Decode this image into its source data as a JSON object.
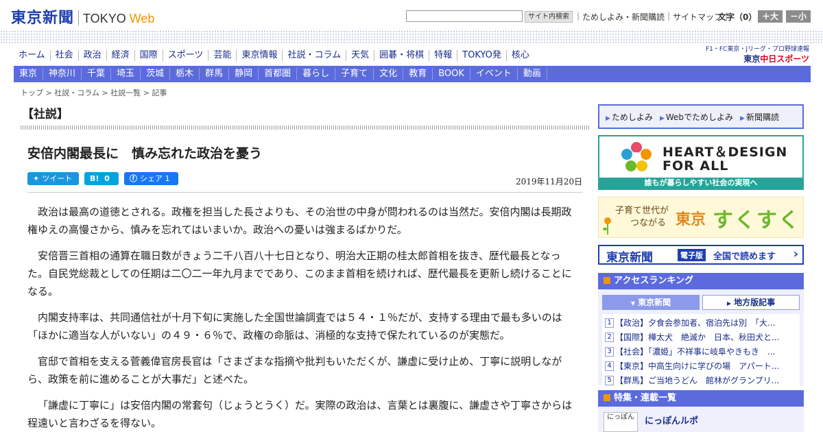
{
  "header": {
    "logo_jp": "東京新聞",
    "logo_en": "TOKYO",
    "logo_en_web": "Web",
    "search_button": "サイト内検索",
    "links": [
      "ためしよみ・新聞購読",
      "サイトマップ"
    ],
    "fontsize_label": "文字（0）",
    "font_large": "＋大",
    "font_small": "－小"
  },
  "nav_main": [
    "ホーム",
    "社会",
    "政治",
    "経済",
    "国際",
    "スポーツ",
    "芸能",
    "東京情報",
    "社説・コラム",
    "天気",
    "囲碁・将棋",
    "特報",
    "TOKYO発",
    "核心"
  ],
  "chunichi": {
    "top": "F1・FC東京・Jリーグ・プロ野球速報",
    "prefix": "東京",
    "main": "中日スポーツ"
  },
  "nav_regional": [
    "東京",
    "神奈川",
    "千葉",
    "埼玉",
    "茨城",
    "栃木",
    "群馬",
    "静岡",
    "首都圏",
    "暮らし",
    "子育て",
    "文化",
    "教育",
    "BOOK",
    "イベント",
    "動画"
  ],
  "breadcrumb": [
    "トップ",
    "社説・コラム",
    "社説一覧",
    "記事"
  ],
  "breadcrumb_sep": " > ",
  "article": {
    "category": "【社説】",
    "headline": "安倍内閣最長に　慎み忘れた政治を憂う",
    "date": "2019年11月20日",
    "tweet_label": "ツイート",
    "hatena_label": "B!",
    "hatena_count": "0",
    "fb_label": "シェア",
    "fb_count": "1",
    "paragraphs": [
      "政治は最高の道徳とされる。政権を担当した長さよりも、その治世の中身が問われるのは当然だ。安倍内閣は長期政権ゆえの高慢さから、慎みを忘れてはいまいか。政治への憂いは強まるばかりだ。",
      "安倍晋三首相の通算在職日数がきょう二千八百八十七日となり、明治大正期の桂太郎首相を抜き、歴代最長となった。自民党総裁としての任期は二〇二一年九月までであり、このまま首相を続ければ、歴代最長を更新し続けることになる。",
      "内閣支持率は、共同通信社が十月下旬に実施した全国世論調査では５４・１％だが、支持する理由で最も多いのは「ほかに適当な人がいない」の４９・６％で、政権の命脈は、消極的な支持で保たれているのが実態だ。",
      "官邸で首相を支える菅義偉官房長官は「さまざまな指摘や批判もいただくが、謙虚に受け止め、丁寧に説明しながら、政策を前に進めることが大事だ」と述べた。",
      "「謙虚に丁寧に」は安倍内閣の常套句（じょうとうく）だ。実際の政治は、言葉とは裏腹に、謙虚さや丁寧さからは程遠いと言わざるを得ない。"
    ]
  },
  "sidebar": {
    "trial_links": [
      "ためしよみ",
      "Webでためしよみ",
      "新聞購読"
    ],
    "heart_design_1": "HEART＆DESIGN",
    "heart_design_2": "FOR ALL",
    "heart_design_foot": "誰もが暮らしやすい社会の実現へ",
    "suku_sub1": "子育て世代が",
    "suku_sub2": "つながる",
    "suku_tokyo": "東京",
    "suku_suku": "すくすく",
    "epaper_logo": "東京新聞",
    "epaper_badge": "電子版",
    "epaper_text": "全国で読めます",
    "ranking_title": "アクセスランキング",
    "ranking_tab_a": "東京新聞",
    "ranking_tab_b": "地方版記事",
    "ranking": [
      {
        "num": "1",
        "text": "【政治】夕食会参加者、宿泊先は別　「大..."
      },
      {
        "num": "2",
        "text": "【国際】樺太犬　絶滅か　日本、秋田犬と..."
      },
      {
        "num": "3",
        "text": "【社会】「濃姫」不祥事に岐阜やきもき　..."
      },
      {
        "num": "4",
        "text": "【東京】中高生向けに学びの場　アパート..."
      },
      {
        "num": "5",
        "text": "【群馬】ご当地うどん　館林がグランプリ..."
      }
    ],
    "special_title": "特集・連載一覧",
    "nippon_icon": "にっぽん",
    "nippon_title": "にっぽんルポ"
  },
  "colors": {
    "brand_blue": "#1f3fae",
    "nav_blue": "#5b6bde",
    "accent_orange": "#f29600",
    "teal": "#28a39a"
  }
}
